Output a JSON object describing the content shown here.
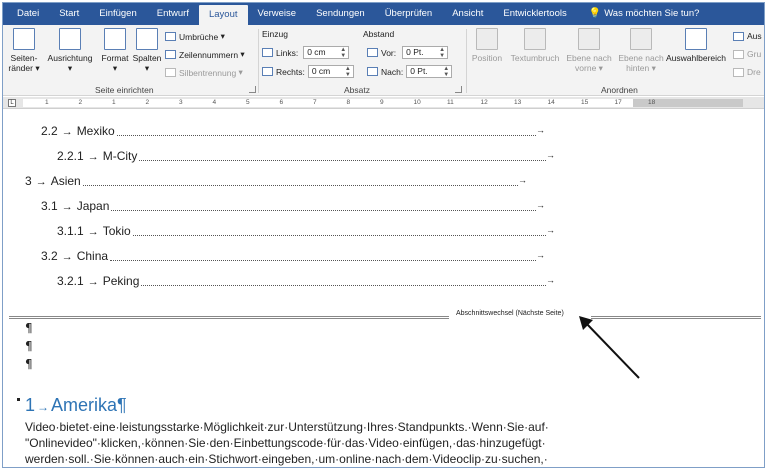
{
  "tabs": [
    "Datei",
    "Start",
    "Einfügen",
    "Entwurf",
    "Layout",
    "Verweise",
    "Sendungen",
    "Überprüfen",
    "Ansicht",
    "Entwicklertools"
  ],
  "active_tab": "Layout",
  "tell_me": "Was möchten Sie tun?",
  "ribbon": {
    "page_setup": {
      "label": "Seite einrichten",
      "margins": "Seiten-\nränder",
      "margins_l1": "Seiten-",
      "margins_l2": "ränder",
      "orientation": "Ausrichtung",
      "size": "Format",
      "columns": "Spalten",
      "breaks": "Umbrüche",
      "line_numbers": "Zeilennummern",
      "hyphenation": "Silbentrennung"
    },
    "paragraph": {
      "label": "Absatz",
      "indent_label": "Einzug",
      "spacing_label": "Abstand",
      "left_label": "Links:",
      "left_value": "0 cm",
      "right_label": "Rechts:",
      "right_value": "0 cm",
      "before_label": "Vor:",
      "before_value": "0 Pt.",
      "after_label": "Nach:",
      "after_value": "0 Pt."
    },
    "arrange": {
      "label": "Anordnen",
      "position": "Position",
      "wrap_text": "Textumbruch",
      "bring_forward_l1": "Ebene nach",
      "bring_forward_l2": "vorne",
      "send_backward_l1": "Ebene nach",
      "send_backward_l2": "hinten",
      "selection_pane": "Auswahlbereich",
      "align": "Aus",
      "group": "Gru",
      "rotate": "Dre"
    }
  },
  "ruler_numbers": [
    "1",
    "2",
    "1",
    "2",
    "3",
    "4",
    "5",
    "6",
    "7",
    "8",
    "9",
    "10",
    "11",
    "12",
    "13",
    "14",
    "15",
    "17",
    "18"
  ],
  "toc": [
    {
      "number": "2.2",
      "title": "Mexiko",
      "level": 2
    },
    {
      "number": "2.2.1",
      "title": "M-City",
      "level": 3
    },
    {
      "number": "3",
      "title": "Asien",
      "level": 1
    },
    {
      "number": "3.1",
      "title": "Japan",
      "level": 2
    },
    {
      "number": "3.1.1",
      "title": "Tokio",
      "level": 3
    },
    {
      "number": "3.2",
      "title": "China",
      "level": 2
    },
    {
      "number": "3.2.1",
      "title": "Peking",
      "level": 3
    }
  ],
  "toc_arrow": "→",
  "section_break": "Abschnittswechsel (Nächste Seite)",
  "pilcrow": "¶",
  "heading": {
    "number": "1",
    "arrow": "→",
    "title": "Amerika¶"
  },
  "body_lines": [
    "Video·bietet·eine·leistungsstarke·Möglichkeit·zur·Unterstützung·Ihres·Standpunkts.·Wenn·Sie·auf·",
    "\"Onlinevideo\"·klicken,·können·Sie·den·Einbettungscode·für·das·Video·einfügen,·das·hinzugefügt·",
    "werden·soll.·Sie·können·auch·ein·Stichwort·eingeben,·um·online·nach·dem·Videoclip·zu·suchen,·"
  ]
}
